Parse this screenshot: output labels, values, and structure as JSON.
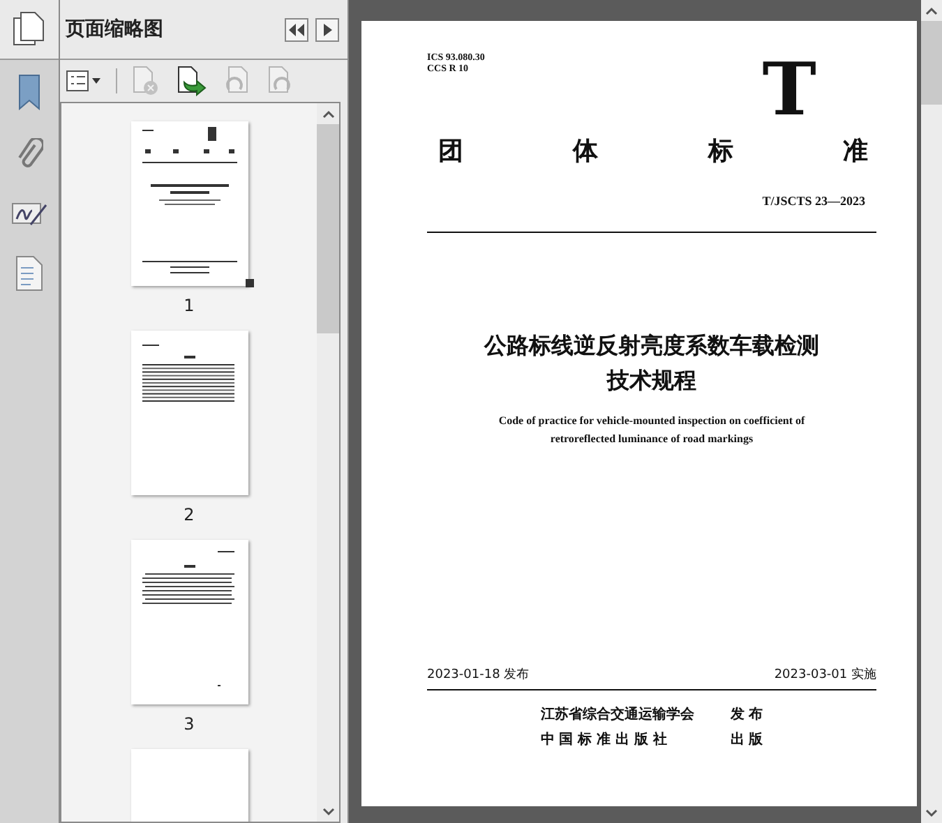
{
  "panel": {
    "title": "页面缩略图"
  },
  "toolbar": [
    {
      "kind": "options",
      "disabled": false
    },
    {
      "kind": "delete",
      "disabled": true
    },
    {
      "kind": "insert",
      "disabled": false
    },
    {
      "kind": "rotate-left",
      "disabled": true
    },
    {
      "kind": "rotate-right",
      "disabled": true
    }
  ],
  "thumbnails": [
    {
      "kind": "cover",
      "label": "1",
      "current": true
    },
    {
      "kind": "contents",
      "label": "2",
      "current": false
    },
    {
      "kind": "foreword",
      "label": "3",
      "current": false
    },
    {
      "kind": "blank",
      "current": false
    }
  ],
  "document": {
    "ics": "ICS 93.080.30",
    "ccs": "CCS R 10",
    "logo": "T",
    "heading": [
      "团",
      "体",
      "标",
      "准"
    ],
    "code": "T/JSCTS 23—2023",
    "title_lines": [
      "公路标线逆反射亮度系数车载检测",
      "技术规程"
    ],
    "english_lines": [
      "Code of practice for vehicle-mounted inspection on coefficient of",
      "retroreflected luminance of road markings"
    ],
    "issue_date": "2023-01-18 发布",
    "implement_date": "2023-03-01 实施",
    "publishers": [
      {
        "name": "江苏省综合交通运输学会",
        "role": "发 布"
      },
      {
        "name": "中 国 标 准 出 版 社",
        "role": "出 版"
      }
    ]
  }
}
